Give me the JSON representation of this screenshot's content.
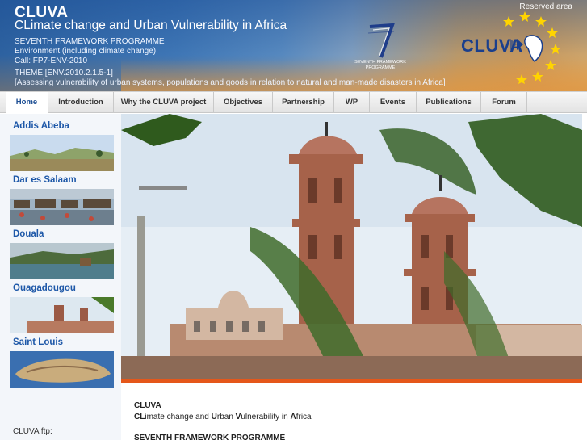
{
  "header": {
    "brand": "CLUVA",
    "subtitle": "CLimate change and Urban Vulnerability in Africa",
    "programme": "SEVENTH FRAMEWORK PROGRAMME",
    "environment": "Environment (including climate change)",
    "call": "Call: FP7-ENV-2010",
    "theme": "THEME [ENV.2010.2.1.5-1]",
    "theme_description": "[Assessing vulnerability of urban systems, populations and goods in relation to natural and man-made disasters in Africa]",
    "reserved_area": "Reserved area",
    "fp7_logo_caption_line1": "SEVENTH FRAMEWORK",
    "fp7_logo_caption_line2": "PROGRAMME",
    "cluva_logo_text": "CLUVA"
  },
  "nav": {
    "items": [
      {
        "label": "Home",
        "active": true
      },
      {
        "label": "Introduction",
        "active": false
      },
      {
        "label": "Why the CLUVA project",
        "active": false
      },
      {
        "label": "Objectives",
        "active": false
      },
      {
        "label": "Partnership",
        "active": false
      },
      {
        "label": "WP",
        "active": false
      },
      {
        "label": "Events",
        "active": false
      },
      {
        "label": "Publications",
        "active": false
      },
      {
        "label": "Forum",
        "active": false
      }
    ]
  },
  "sidebar": {
    "cities": [
      {
        "name": "Addis Abeba"
      },
      {
        "name": "Dar es Salaam"
      },
      {
        "name": "Douala"
      },
      {
        "name": "Ouagadougou"
      },
      {
        "name": "Saint Louis"
      }
    ],
    "ftp_label": "CLUVA ftp:"
  },
  "content": {
    "title": "CLUVA",
    "fp7": "SEVENTH FRAMEWORK PROGRAMME"
  },
  "colors": {
    "accent": "#1e58a8",
    "divider": "#e5571a",
    "nav_bg": "#e8e8e8"
  }
}
